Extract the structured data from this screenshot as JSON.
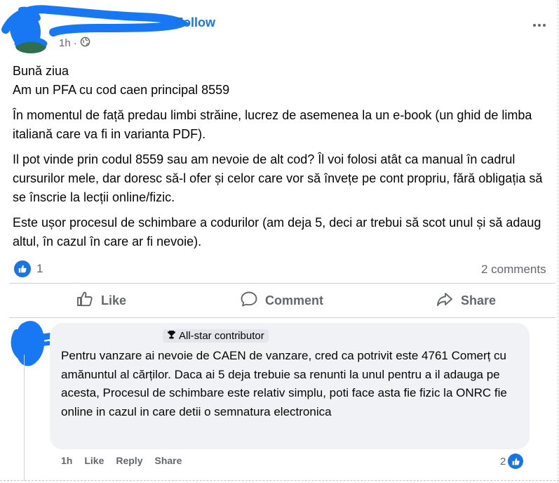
{
  "post": {
    "follow_label": "Follow",
    "time": "1h",
    "time_separator": "·",
    "paragraphs": [
      "Bună ziua",
      "Am un PFA cu cod caen principal 8559",
      "În momentul de față predau limbi străine, lucrez de asemenea la un e-book (un ghid de limba italiană care va fi in varianta PDF).",
      "Il pot vinde prin codul 8559 sau am nevoie de alt cod? Îl voi folosi atât ca manual în cadrul cursurilor mele, dar doresc să-l ofer și celor care vor să învețe pe cont propriu, fără obligația să se înscrie la lecții online/fizic.",
      "Este ușor procesul de schimbare a codurilor (am deja 5, deci ar trebui să scot unul și să adaug altul, în cazul în care ar fi nevoie)."
    ],
    "reaction_count": "1",
    "comments_count": "2 comments"
  },
  "actions": {
    "like": "Like",
    "comment": "Comment",
    "share": "Share"
  },
  "comment": {
    "badge": "All-star contributor",
    "text": "Pentru vanzare ai nevoie de CAEN de vanzare, cred ca potrivit este 4761 Comerț cu amănuntul al cărților. Daca ai 5 deja trebuie sa renunti la unul pentru a il adauga pe acesta, Procesul de schimbare este relativ simplu, poti face asta fie fizic la ONRC fie online in cazul in care detii o semnatura electronica",
    "time": "1h",
    "like_label": "Like",
    "reply_label": "Reply",
    "share_label": "Share",
    "reaction_count": "2"
  },
  "colors": {
    "accent": "#1b74e4",
    "redaction": "#1877f2",
    "muted_text": "#65676b",
    "comment_bg": "#f0f2f5"
  },
  "icons": {
    "globe": "globe-icon",
    "more": "more-options-icon",
    "like": "thumbs-up-icon",
    "comment": "comment-icon",
    "share": "share-arrow-icon",
    "badge": "trophy-icon"
  }
}
